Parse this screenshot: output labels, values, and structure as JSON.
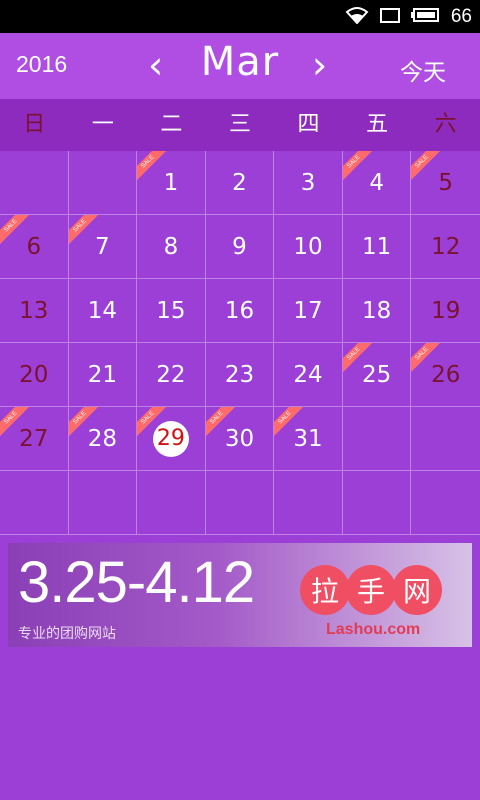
{
  "status_bar": {
    "battery_level": "66",
    "icons": [
      "wifi-icon",
      "recent-apps-icon",
      "battery-icon"
    ]
  },
  "header": {
    "year": "2016",
    "month": "Mar",
    "prev_label": "‹",
    "next_label": "›",
    "today_label": "今天"
  },
  "weekdays": [
    "日",
    "一",
    "二",
    "三",
    "四",
    "五",
    "六"
  ],
  "calendar": {
    "today": "29",
    "sale_label": "SALE",
    "rows": [
      [
        {
          "day": "",
          "sale": false
        },
        {
          "day": "",
          "sale": false
        },
        {
          "day": "1",
          "sale": true
        },
        {
          "day": "2",
          "sale": false
        },
        {
          "day": "3",
          "sale": false
        },
        {
          "day": "4",
          "sale": true
        },
        {
          "day": "5",
          "sale": true
        }
      ],
      [
        {
          "day": "6",
          "sale": true
        },
        {
          "day": "7",
          "sale": true
        },
        {
          "day": "8",
          "sale": false
        },
        {
          "day": "9",
          "sale": false
        },
        {
          "day": "10",
          "sale": false
        },
        {
          "day": "11",
          "sale": false
        },
        {
          "day": "12",
          "sale": false
        }
      ],
      [
        {
          "day": "13",
          "sale": false
        },
        {
          "day": "14",
          "sale": false
        },
        {
          "day": "15",
          "sale": false
        },
        {
          "day": "16",
          "sale": false
        },
        {
          "day": "17",
          "sale": false
        },
        {
          "day": "18",
          "sale": false
        },
        {
          "day": "19",
          "sale": false
        }
      ],
      [
        {
          "day": "20",
          "sale": false
        },
        {
          "day": "21",
          "sale": false
        },
        {
          "day": "22",
          "sale": false
        },
        {
          "day": "23",
          "sale": false
        },
        {
          "day": "24",
          "sale": false
        },
        {
          "day": "25",
          "sale": true
        },
        {
          "day": "26",
          "sale": true
        }
      ],
      [
        {
          "day": "27",
          "sale": true
        },
        {
          "day": "28",
          "sale": true
        },
        {
          "day": "29",
          "sale": true
        },
        {
          "day": "30",
          "sale": true
        },
        {
          "day": "31",
          "sale": true
        },
        {
          "day": "",
          "sale": false
        },
        {
          "day": "",
          "sale": false
        }
      ],
      [
        {
          "day": "",
          "sale": false
        },
        {
          "day": "",
          "sale": false
        },
        {
          "day": "",
          "sale": false
        },
        {
          "day": "",
          "sale": false
        },
        {
          "day": "",
          "sale": false
        },
        {
          "day": "",
          "sale": false
        },
        {
          "day": "",
          "sale": false
        }
      ]
    ]
  },
  "banner": {
    "dates": "3.25-4.12",
    "slogan": "专业的团购网站",
    "logo_chars": [
      "拉",
      "手",
      "网"
    ],
    "logo_url": "Lashou.com"
  },
  "colors": {
    "background": "#9b3fd6",
    "header": "#b04de3",
    "weekday_bar": "#8d2bbf",
    "weekend_text": "#7a1230",
    "sale_ribbon": "#ff6a6a",
    "today_text": "#d01212",
    "logo": "#f04e63"
  }
}
